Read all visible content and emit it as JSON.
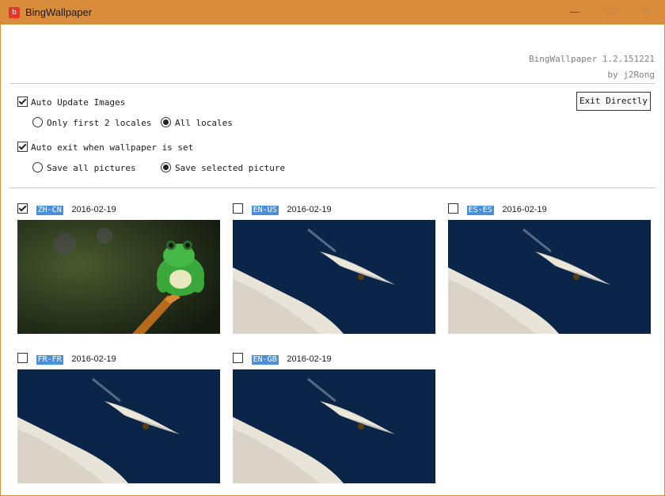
{
  "window": {
    "title": "BingWallpaper"
  },
  "titlebar": {
    "minimize_glyph": "—",
    "maximize_glyph": "☐",
    "close_glyph": "✕",
    "icon_glyph": "b"
  },
  "version": {
    "app": "BingWallpaper 1.2.151221",
    "author": "by j2Rong"
  },
  "options": {
    "auto_update": {
      "label": "Auto Update Images",
      "checked": true
    },
    "locale_radios": [
      {
        "label": "Only first 2 locales",
        "checked": false
      },
      {
        "label": "All locales",
        "checked": true
      }
    ],
    "auto_exit": {
      "label": "Auto exit when wallpaper is set",
      "checked": true
    },
    "save_radios": [
      {
        "label": "Save all pictures",
        "checked": false
      },
      {
        "label": "Save selected picture",
        "checked": true
      }
    ],
    "exit_button": "Exit Directly"
  },
  "wallpapers": [
    {
      "locale": "ZH-CN",
      "date": "2016-02-19",
      "checked": true,
      "image": "frog"
    },
    {
      "locale": "EN-US",
      "date": "2016-02-19",
      "checked": false,
      "image": "feather"
    },
    {
      "locale": "ES-ES",
      "date": "2016-02-19",
      "checked": false,
      "image": "feather"
    },
    {
      "locale": "FR-FR",
      "date": "2016-02-19",
      "checked": false,
      "image": "feather"
    },
    {
      "locale": "EN-GB",
      "date": "2016-02-19",
      "checked": false,
      "image": "feather"
    }
  ],
  "colors": {
    "titlebar": "#d98c3a",
    "locale_tag": "#4a90d9"
  }
}
